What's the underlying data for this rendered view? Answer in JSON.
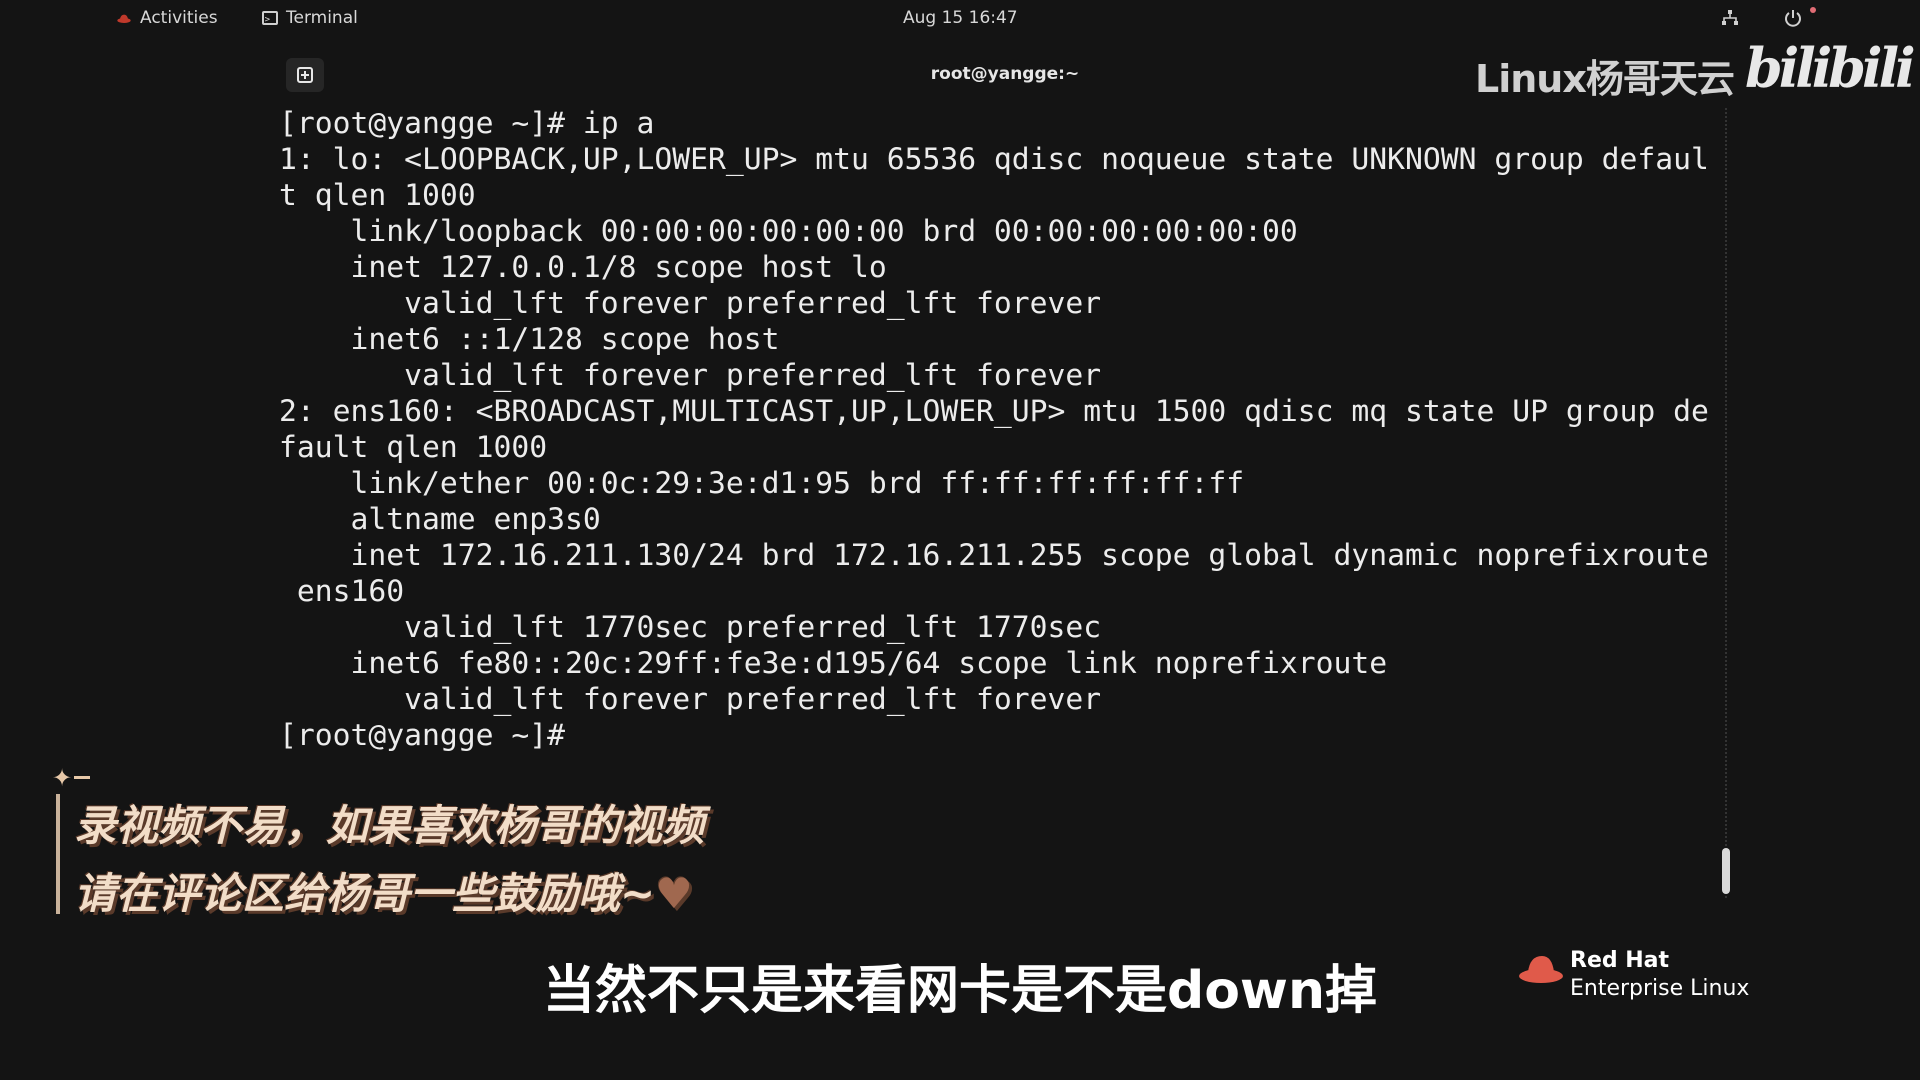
{
  "topbar": {
    "activities_label": "Activities",
    "app_label": "Terminal",
    "clock": "Aug 15  16:47"
  },
  "terminal": {
    "title": "root@yangge:~",
    "output": "[root@yangge ~]# ip a\n1: lo: <LOOPBACK,UP,LOWER_UP> mtu 65536 qdisc noqueue state UNKNOWN group defaul\nt qlen 1000\n    link/loopback 00:00:00:00:00:00 brd 00:00:00:00:00:00\n    inet 127.0.0.1/8 scope host lo\n       valid_lft forever preferred_lft forever\n    inet6 ::1/128 scope host\n       valid_lft forever preferred_lft forever\n2: ens160: <BROADCAST,MULTICAST,UP,LOWER_UP> mtu 1500 qdisc mq state UP group de\nfault qlen 1000\n    link/ether 00:0c:29:3e:d1:95 brd ff:ff:ff:ff:ff:ff\n    altname enp3s0\n    inet 172.16.211.130/24 brd 172.16.211.255 scope global dynamic noprefixroute\n ens160\n       valid_lft 1770sec preferred_lft 1770sec\n    inet6 fe80::20c:29ff:fe3e:d195/64 scope link noprefixroute\n       valid_lft forever preferred_lft forever\n[root@yangge ~]#"
  },
  "overlay": {
    "watermark": "Linux杨哥天云",
    "bilibili": "bilibili",
    "promo_line1": "录视频不易，如果喜欢杨哥的视频",
    "promo_line2": "请在评论区给杨哥一些鼓励哦~",
    "subtitle": "当然不只是来看网卡是不是down掉",
    "brand_line1": "Red Hat",
    "brand_line2": "Enterprise Linux"
  },
  "colors": {
    "background": "#141414",
    "text": "#ececec",
    "redhat": "#ee0000"
  }
}
